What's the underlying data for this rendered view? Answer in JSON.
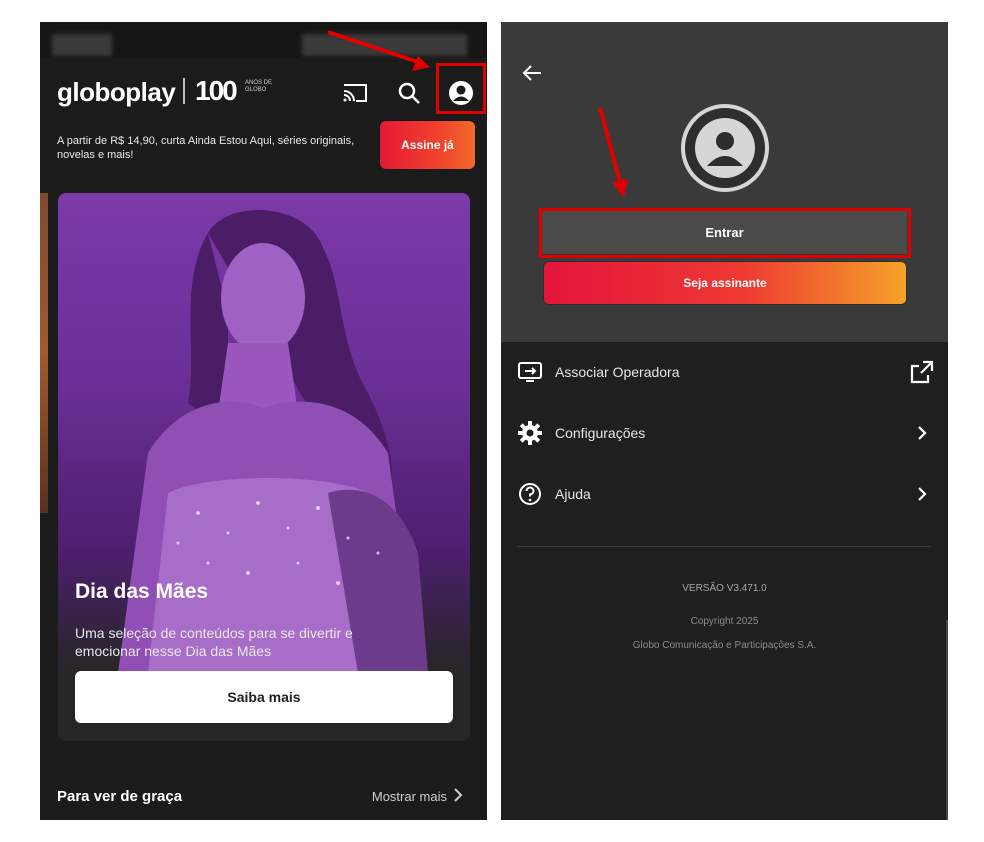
{
  "left_screen": {
    "app_logo": "globoplay",
    "anniversary_logo": "100",
    "anniversary_sub": "ANOS DE GLOBO",
    "promo_text": "A partir de R$ 14,90, curta Ainda Estou Aqui, séries originais, novelas e mais!",
    "subscribe_button": "Assine já",
    "featured": {
      "title": "Dia das Mães",
      "description": "Uma seleção de conteúdos para se divertir e emocionar nesse Dia das Mães",
      "button": "Saiba mais"
    },
    "section": {
      "title": "Para ver de graça",
      "more_link": "Mostrar mais"
    },
    "icons": [
      "cast-icon",
      "search-icon",
      "profile-icon"
    ]
  },
  "right_screen": {
    "login_button": "Entrar",
    "subscribe_button": "Seja assinante",
    "menu": [
      {
        "label": "Associar Operadora",
        "icon": "tv-link-icon",
        "end_icon": "external-link-icon"
      },
      {
        "label": "Configurações",
        "icon": "gear-icon",
        "end_icon": "chevron-right-icon"
      },
      {
        "label": "Ajuda",
        "icon": "help-icon",
        "end_icon": "chevron-right-icon"
      }
    ],
    "version": "VERSÃO V3.471.0",
    "copyright": "Copyright 2025",
    "company": "Globo Comunicação e Participações S.A."
  },
  "colors": {
    "highlight": "#e00000",
    "brand_red": "#e41a35",
    "brand_orange": "#f26a2a",
    "hero_purple": "#6b2e96"
  }
}
